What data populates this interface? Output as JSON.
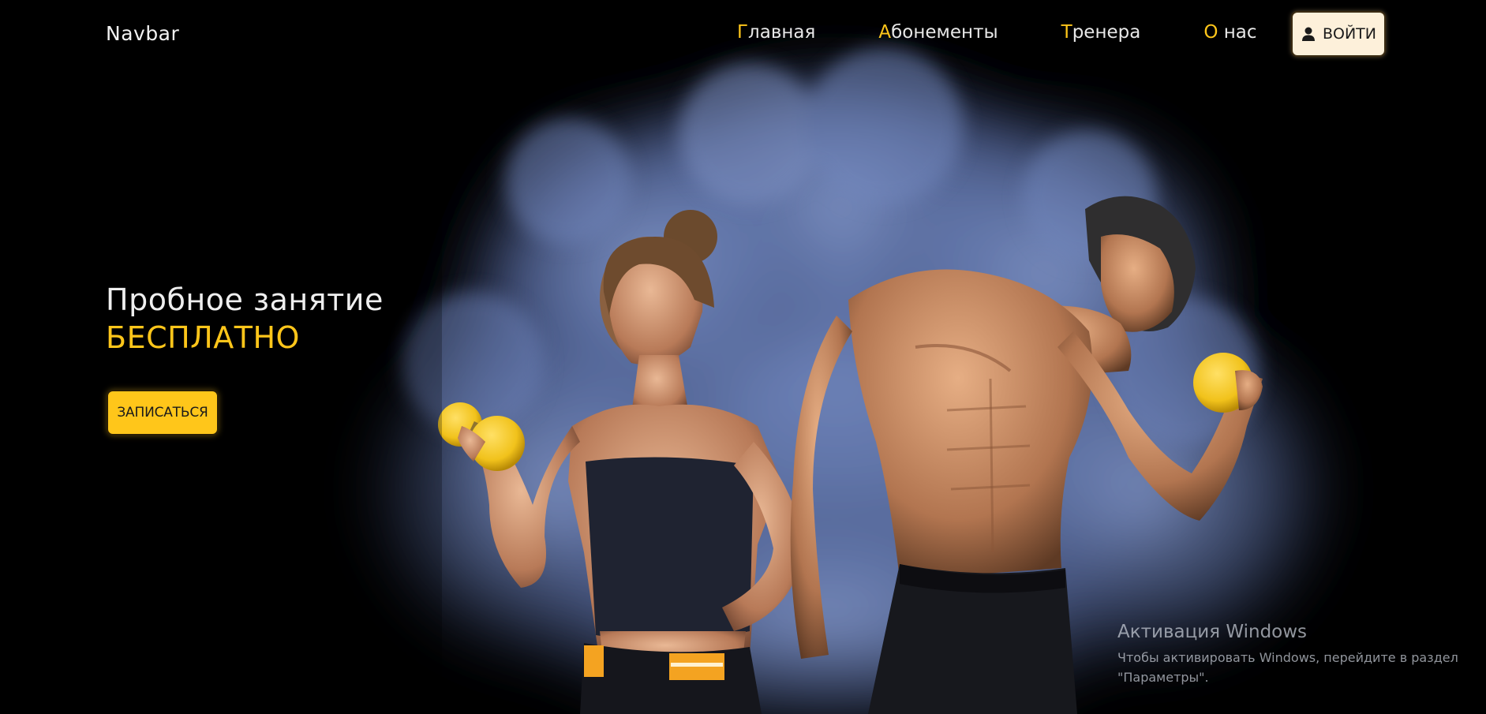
{
  "navbar": {
    "brand": "Navbar",
    "links": [
      {
        "first": "Г",
        "rest": "лавная"
      },
      {
        "first": "А",
        "rest": "бонементы"
      },
      {
        "first": "Т",
        "rest": "ренера"
      },
      {
        "first": "О",
        "rest": " нас"
      }
    ],
    "login_label": "ВОЙТИ",
    "login_icon": "user-icon"
  },
  "hero": {
    "title": "Пробное занятие",
    "accent": "БЕСПЛАТНО",
    "cta_label": "ЗАПИСАТЬСЯ",
    "image": "woman-and-man-with-yellow-dumbbells-in-blue-smoke"
  },
  "windows_watermark": {
    "title": "Активация Windows",
    "line1": "Чтобы активировать Windows, перейдите в раздел",
    "line2": "\"Параметры\"."
  },
  "colors": {
    "accent": "#ffc61a",
    "background": "#000000",
    "smoke": "#5f74a8",
    "login_bg": "#fdf0da"
  }
}
